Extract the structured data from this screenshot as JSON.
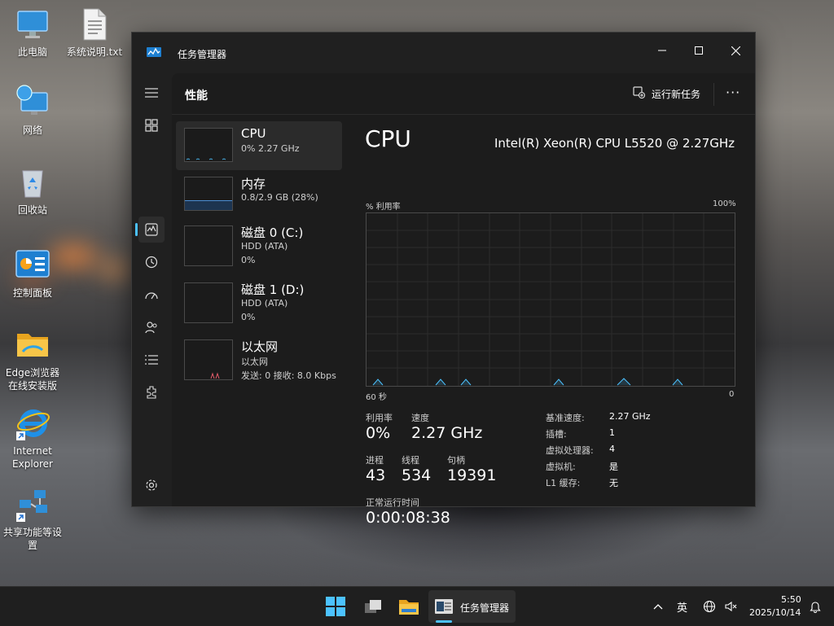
{
  "desktop": {
    "icons": [
      {
        "label": "此电脑"
      },
      {
        "label": "系统说明.txt"
      },
      {
        "label": "网络"
      },
      {
        "label": "回收站"
      },
      {
        "label": "控制面板"
      },
      {
        "label_line1": "Edge浏览器",
        "label_line2": "在线安装版"
      },
      {
        "label_line1": "Internet",
        "label_line2": "Explorer"
      },
      {
        "label_line1": "共享功能等设",
        "label_line2": "置"
      }
    ]
  },
  "window": {
    "title": "任务管理器",
    "controls": {
      "minimize": "—",
      "maximize": "☐",
      "close": "✕"
    },
    "header": {
      "title": "性能",
      "run_new_task": "运行新任务",
      "more": "···"
    },
    "nav_icons": [
      "menu-icon",
      "processes-icon",
      "performance-icon",
      "app-history-icon",
      "startup-apps-icon",
      "users-icon",
      "details-icon",
      "services-icon",
      "settings-icon"
    ],
    "perf_list": [
      {
        "name": "CPU",
        "sub1": "0%  2.27 GHz"
      },
      {
        "name": "内存",
        "sub1": "0.8/2.9 GB (28%)"
      },
      {
        "name": "磁盘 0 (C:)",
        "sub1": "HDD (ATA)",
        "sub2": "0%"
      },
      {
        "name": "磁盘 1 (D:)",
        "sub1": "HDD (ATA)",
        "sub2": "0%"
      },
      {
        "name": "以太网",
        "sub1": "以太网",
        "sub2": "发送: 0  接收: 8.0 Kbps"
      }
    ],
    "cpu": {
      "title": "CPU",
      "model": "Intel(R) Xeon(R) CPU L5520 @ 2.27GHz",
      "graph_label": "% 利用率",
      "graph_max": "100%",
      "graph_time": "60 秒",
      "graph_min": "0",
      "utilization_label": "利用率",
      "utilization": "0%",
      "speed_label": "速度",
      "speed": "2.27 GHz",
      "processes_label": "进程",
      "processes": "43",
      "threads_label": "线程",
      "threads": "534",
      "handles_label": "句柄",
      "handles": "19391",
      "uptime_label": "正常运行时间",
      "uptime": "0:00:08:38",
      "details": [
        {
          "k": "基准速度:",
          "v": "2.27 GHz"
        },
        {
          "k": "插槽:",
          "v": "1"
        },
        {
          "k": "虚拟处理器:",
          "v": "4"
        },
        {
          "k": "虚拟机:",
          "v": "是"
        },
        {
          "k": "L1 缓存:",
          "v": "无"
        }
      ]
    }
  },
  "taskbar": {
    "active_app_label": "任务管理器",
    "ime": "英",
    "time": "5:50",
    "date": "2025/10/14"
  },
  "colors": {
    "accent": "#4cc2ff",
    "window_bg": "#202020",
    "content_bg": "#1c1c1c",
    "selected": "#2b2b2b"
  }
}
